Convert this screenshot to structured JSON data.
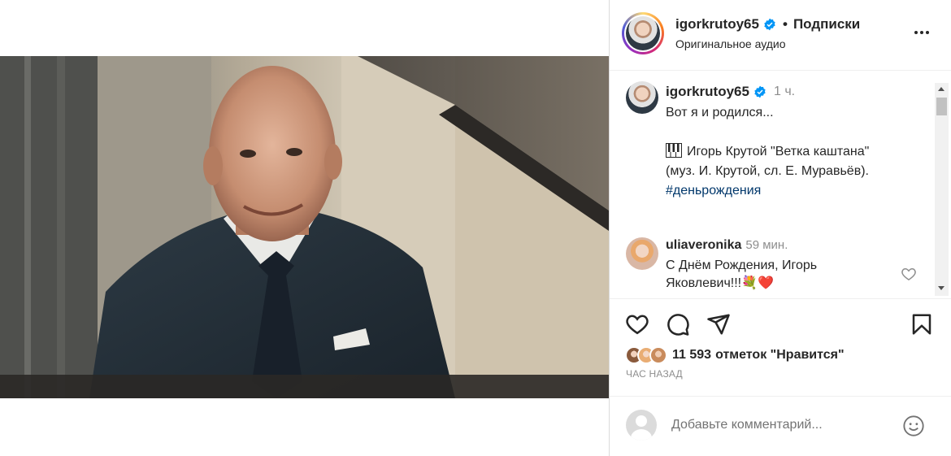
{
  "header": {
    "username": "igorkrutoy65",
    "separator": "•",
    "follow_label": "Подписки",
    "subtitle": "Оригинальное аудио",
    "more_icon": "more-horizontal-icon"
  },
  "caption": {
    "username": "igorkrutoy65",
    "time": "1 ч.",
    "lines": [
      "Вот я и родился...",
      "",
      "Игорь Крутой \"Ветка каштана\"",
      "(муз. И. Крутой, сл. Е. Муравьёв).",
      "#деньрождения"
    ]
  },
  "comment": {
    "username": "uliaveronika",
    "time": "59 мин.",
    "text": "С Днём Рождения, Игорь Яковлевич!!!💐❤️"
  },
  "actions": {
    "like_icon": "heart-icon",
    "comment_icon": "comment-icon",
    "share_icon": "send-icon",
    "save_icon": "bookmark-icon"
  },
  "likes": {
    "count": "11 593",
    "label": "отметок \"Нравится\""
  },
  "posted_ago": "ЧАС НАЗАД",
  "add_comment": {
    "placeholder": "Добавьте комментарий..."
  },
  "video": {
    "muted": true,
    "mute_icon": "volume-muted-icon"
  },
  "colors": {
    "text": "#262626",
    "secondary": "#8e8e8e",
    "link": "#00376b",
    "verified": "#0095f6",
    "divider": "#dbdbdb"
  }
}
